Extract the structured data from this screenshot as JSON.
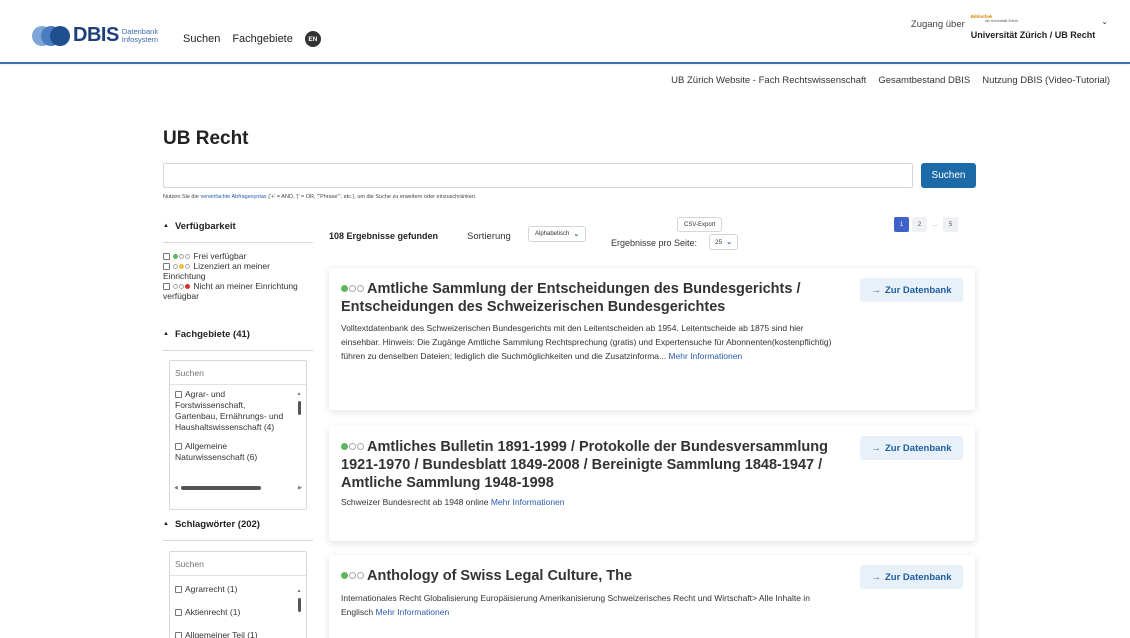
{
  "header": {
    "logo": {
      "name": "DBIS",
      "sub1": "Datenbank",
      "sub2": "Infosystem"
    },
    "nav": [
      {
        "label": "Suchen"
      },
      {
        "label": "Fachgebiete"
      }
    ],
    "lang_badge": "EN",
    "access": {
      "label": "Zugang über",
      "institution": "Universität Zürich / UB Recht",
      "library_logo_line1": "Bibliothek",
      "library_logo_line2": "der Universität Zürich"
    }
  },
  "secondary_nav": [
    {
      "label": "UB Zürich Website - Fach Rechtswissenschaft"
    },
    {
      "label": "Gesamtbestand DBIS"
    },
    {
      "label": "Nutzung DBIS (Video-Tutorial)"
    }
  ],
  "page_title": "UB Recht",
  "search": {
    "value": "",
    "placeholder": "",
    "button": "Suchen",
    "hint_prefix": "Nutzen Sie die",
    "hint_link": "vereinfachte Abfragesyntax",
    "hint_suffix": "('+' = AND, '|' = OR, '\"Phrase\"', etc.), um die Suche zu erweitern oder einzuschränken."
  },
  "sidebar": {
    "availability": {
      "title": "Verfügbarkeit",
      "items": [
        {
          "label": "Frei verfügbar"
        },
        {
          "label": "Lizenziert an meiner Einrichtung"
        },
        {
          "label": "Nicht an meiner Einrichtung verfügbar"
        }
      ]
    },
    "subjects": {
      "title": "Fachgebiete (41)",
      "search_placeholder": "Suchen",
      "items": [
        {
          "label": "Agrar- und Forstwissenschaft, Gartenbau, Ernährungs- und Haushaltswissenschaft (4)"
        },
        {
          "label": "Allgemeine Naturwissenschaft (6)"
        }
      ]
    },
    "keywords": {
      "title": "Schlagwörter (202)",
      "search_placeholder": "Suchen",
      "items": [
        {
          "label": "Agrarrecht (1)"
        },
        {
          "label": "Aktienrecht (1)"
        },
        {
          "label": "Allgemeiner Teil (1)"
        }
      ]
    }
  },
  "results": {
    "count": "108 Ergebnisse gefunden",
    "sort_label": "Sortierung",
    "sort_value": "Alphabetisch",
    "csv_export": "CSV-Export",
    "per_page_label": "Ergebnisse pro Seite:",
    "per_page_value": "25",
    "pages": [
      "1",
      "2",
      "...",
      "5"
    ],
    "items": [
      {
        "title": "Amtliche Sammlung der Entscheidungen des Bundesgerichts / Entscheidungen des Schweizerischen Bundesgerichtes",
        "description": "Volltextdatenbank des Schweizerischen Bundesgerichts mit den Leitentscheiden ab 1954. Leitentscheide ab 1875 sind hier einsehbar. Hinweis: Die Zugänge Amtliche Sammlung Rechtsprechung (gratis) und Expertensuche für Abonnenten(kostenpflichtig) führen zu denselben Dateien; lediglich die Suchmöglichkeiten und die Zusatzinforma...",
        "more": "Mehr Informationen",
        "button": "Zur Datenbank"
      },
      {
        "title": "Amtliches Bulletin 1891-1999 / Protokolle der Bundesversammlung 1921-1970 / Bundesblatt 1849-2008 / Bereinigte Sammlung 1848-1947 / Amtliche Sammlung 1948-1998",
        "description": "Schweizer Bundesrecht ab 1948 online",
        "more": "Mehr Informationen",
        "button": "Zur Datenbank"
      },
      {
        "title": "Anthology of Swiss Legal Culture, The",
        "description": "Internationales Recht Globalisierung Europäisierung Amerikanisierung Schweizerisches Recht und Wirtschaft> Alle Inhalte in Englisch",
        "more": "Mehr Informationen",
        "button": "Zur Datenbank"
      }
    ]
  },
  "colors": {
    "accent": "#1d6aa8",
    "free": "#5cb85c",
    "licensed": "#e8c437",
    "unavailable": "#d9302c",
    "page_active": "#3e62c8"
  }
}
